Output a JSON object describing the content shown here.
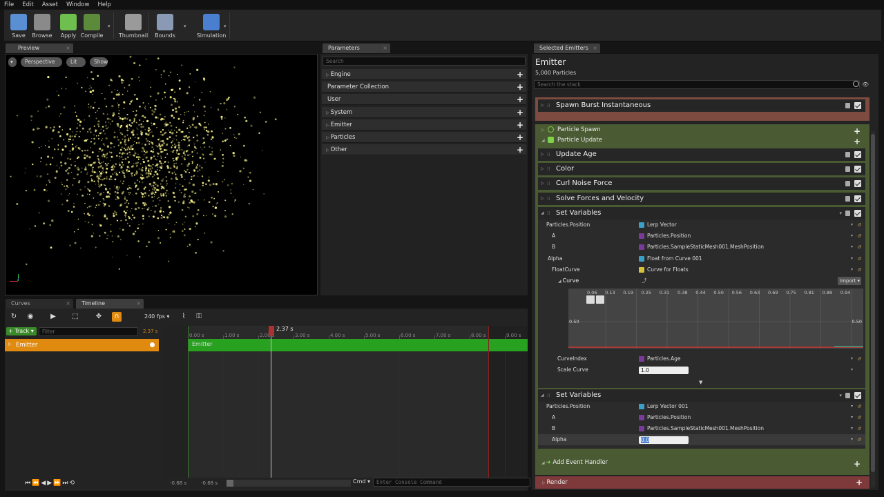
{
  "menu": [
    "File",
    "Edit",
    "Asset",
    "Window",
    "Help"
  ],
  "toolbar": [
    {
      "name": "save-button",
      "label": "Save",
      "color": "#5a8fd4"
    },
    {
      "name": "browse-button",
      "label": "Browse",
      "color": "#8a8a8a"
    },
    {
      "name": "apply-button",
      "label": "Apply",
      "color": "#6fbf4e"
    },
    {
      "name": "compile-button",
      "label": "Compile",
      "color": "#5a8a3a"
    },
    {
      "name": "thumbnail-button",
      "label": "Thumbnail",
      "color": "#9a9a9a"
    },
    {
      "name": "bounds-button",
      "label": "Bounds",
      "color": "#8a9ab4"
    },
    {
      "name": "simulation-button",
      "label": "Simulation",
      "color": "#4a7fd0"
    }
  ],
  "preview": {
    "tab": "Preview",
    "perspective": "Perspective",
    "lit": "Lit",
    "show": "Show"
  },
  "parameters": {
    "tab": "Parameters",
    "search_placeholder": "Search",
    "rows": [
      "Engine",
      "Parameter Collection",
      "User",
      "System",
      "Emitter",
      "Particles",
      "Other"
    ]
  },
  "emitters": {
    "tab": "Selected Emitters",
    "title": "Emitter",
    "count": "5,000 Particles",
    "search_placeholder": "Search the stack",
    "spawn_burst": "Spawn Burst Instantaneous",
    "particle_spawn": "Particle Spawn",
    "particle_update": "Particle Update",
    "modules": [
      "Update Age",
      "Color",
      "Curl Noise Force",
      "Solve Forces and Velocity"
    ],
    "setvars1": {
      "title": "Set Variables",
      "rows": [
        {
          "k": "Particles.Position",
          "v": "Lerp Vector",
          "c": "#3aa0c8"
        },
        {
          "k": "A",
          "v": "Particles.Position",
          "c": "#7a3a9a"
        },
        {
          "k": "B",
          "v": "Particles.SampleStaticMesh001.MeshPosition",
          "c": "#7a3a9a"
        },
        {
          "k": "Alpha",
          "v": "Float from Curve 001",
          "c": "#3aa0c8"
        },
        {
          "k": "FloatCurve",
          "v": "Curve for Floats",
          "c": "#d4c23a"
        }
      ],
      "curve_label": "Curve",
      "import": "Import",
      "curve_ticks": [
        "0.06",
        "0.13",
        "0.19",
        "0.25",
        "0.31",
        "0.38",
        "0.44",
        "0.50",
        "0.56",
        "0.63",
        "0.69",
        "0.75",
        "0.81",
        "0.88",
        "0.94"
      ],
      "curve_y": "0.50",
      "curve_index": {
        "k": "CurveIndex",
        "v": "Particles.Age"
      },
      "scale_curve": {
        "k": "Scale Curve",
        "v": "1.0"
      }
    },
    "setvars2": {
      "title": "Set Variables",
      "rows": [
        {
          "k": "Particles.Position",
          "v": "Lerp Vector 001",
          "c": "#3aa0c8"
        },
        {
          "k": "A",
          "v": "Particles.Position",
          "c": "#7a3a9a"
        },
        {
          "k": "B",
          "v": "Particles.SampleStaticMesh001.MeshPosition",
          "c": "#7a3a9a"
        }
      ],
      "alpha": {
        "k": "Alpha",
        "v": "0.0"
      }
    },
    "add_event": "Add Event Handler",
    "render": "Render"
  },
  "timeline": {
    "curves_tab": "Curves",
    "timeline_tab": "Timeline",
    "fps": "240 fps",
    "track": "Track",
    "filter_placeholder": "Filter",
    "time_small": "2.37 s",
    "playhead": "2.37 s",
    "ticks": [
      "0.00 s",
      "1.00 s",
      "2.00 s",
      "3.00 s",
      "4.00 s",
      "5.00 s",
      "6.00 s",
      "7.00 s",
      "8.00 s",
      "9.00 s"
    ],
    "track_name": "Emitter",
    "bar_label": "Emitter",
    "start_a": "-0.68 s",
    "start_b": "-0.68 s"
  },
  "console": {
    "cmd": "Cmd",
    "placeholder": "Enter Console Command"
  }
}
